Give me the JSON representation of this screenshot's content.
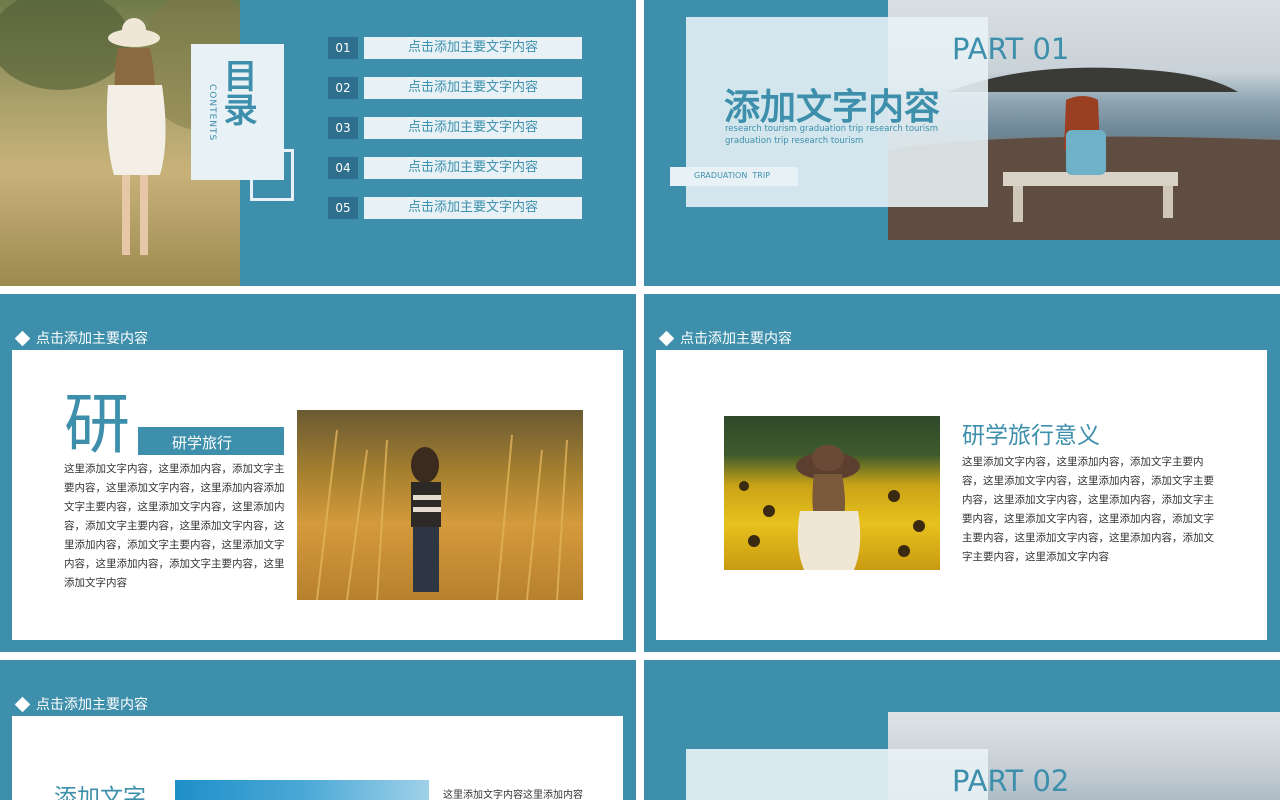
{
  "slide1": {
    "title_cn": "目录",
    "title_en": "CONTENTS",
    "items": [
      {
        "num": "01",
        "label": "点击添加主要文字内容"
      },
      {
        "num": "02",
        "label": "点击添加主要文字内容"
      },
      {
        "num": "03",
        "label": "点击添加主要文字内容"
      },
      {
        "num": "04",
        "label": "点击添加主要文字内容"
      },
      {
        "num": "05",
        "label": "点击添加主要文字内容"
      }
    ]
  },
  "slide2": {
    "part": "PART 01",
    "heading": "添加文字内容",
    "sub_line1": "research tourism graduation trip research tourism",
    "sub_line2": "graduation trip research tourism",
    "tag": "GRADUATION  TRIP"
  },
  "slide3": {
    "title": "点击添加主要内容",
    "big_char": "研",
    "label": "研学旅行",
    "body": "这里添加文字内容，这里添加内容，添加文字主要内容，这里添加文字内容，这里添加内容添加文字主要内容，这里添加文字内容，这里添加内容，添加文字主要内容，这里添加文字内容，这里添加内容，添加文字主要内容，这里添加文字内容，这里添加内容，添加文字主要内容，这里添加文字内容"
  },
  "slide4": {
    "title": "点击添加主要内容",
    "heading": "研学旅行意义",
    "body": "这里添加文字内容，这里添加内容，添加文字主要内容，这里添加文字内容，这里添加内容，添加文字主要内容，这里添加文字内容，这里添加内容，添加文字主要内容，这里添加文字内容，这里添加内容，添加文字主要内容，这里添加文字内容，这里添加内容，添加文字主要内容，这里添加文字内容"
  },
  "slide5": {
    "title": "点击添加主要内容",
    "heading": "添加文字",
    "body": "这里添加文字内容这里添加内容"
  },
  "slide6": {
    "part": "PART 02"
  },
  "colors": {
    "accent": "#3d8fab",
    "accent_dark": "#2d6f8c",
    "light": "#e8f2f6"
  }
}
